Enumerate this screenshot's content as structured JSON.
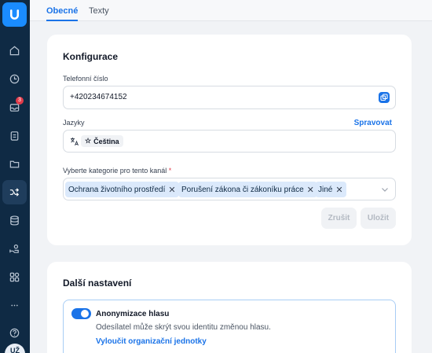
{
  "sidebar": {
    "badge_count": "3",
    "avatar_initials": "UŽ",
    "items": [
      {
        "icon": "home-icon"
      },
      {
        "icon": "clock-icon"
      },
      {
        "icon": "inbox-icon"
      },
      {
        "icon": "clipboard-icon"
      },
      {
        "icon": "folder-icon"
      },
      {
        "icon": "shuffle-icon"
      },
      {
        "icon": "database-icon"
      },
      {
        "icon": "users-icon"
      },
      {
        "icon": "apps-icon"
      },
      {
        "icon": "more-icon"
      },
      {
        "icon": "help-icon"
      }
    ]
  },
  "tabs": [
    {
      "label": "Obecné"
    },
    {
      "label": "Texty"
    }
  ],
  "config": {
    "title": "Konfigurace",
    "phone_label": "Telefonní číslo",
    "phone_value": "+420234674152",
    "languages_label": "Jazyky",
    "manage_link": "Spravovat",
    "language_chip": "Čeština",
    "categories_label": "Vyberte kategorie pro tento kanál",
    "required_mark": "*",
    "categories": [
      "Ochrana životního prostředí",
      "Porušení zákona či zákoníku práce",
      "Jiné"
    ],
    "cancel_label": "Zrušit",
    "save_label": "Uložit"
  },
  "more": {
    "title": "Další nastavení",
    "option_title": "Anonymizace hlasu",
    "option_desc": "Odesílatel může skrýt svou identitu změnou hlasu.",
    "option_link": "Vyloučit organizační jednotky"
  },
  "colors": {
    "sidebar": "#0f2a44",
    "accent": "#1a73e8",
    "chip_bg": "#dbe9fb"
  }
}
